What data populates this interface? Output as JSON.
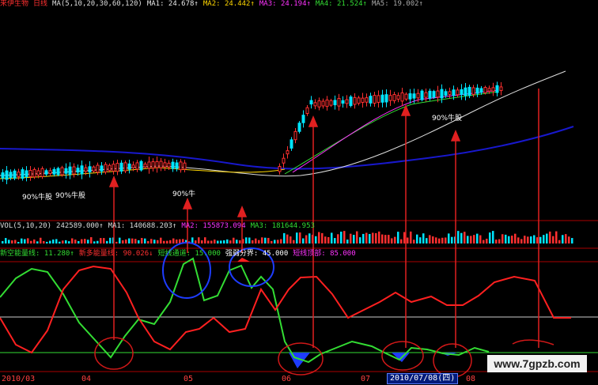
{
  "header": {
    "stock": "来伊生物",
    "period": "日线",
    "ma_label": "MA(5,10,20,30,60,120)",
    "items": [
      {
        "label": "MA1: 24.678↑",
        "color": "#e8e8e8"
      },
      {
        "label": "MA2: 24.442↑",
        "color": "#ffd700"
      },
      {
        "label": "MA3: 24.194↑",
        "color": "#ff33ff"
      },
      {
        "label": "MA4: 21.524↑",
        "color": "#33dd33"
      },
      {
        "label": "MA5: 19.002↑",
        "color": "#aaaaaa"
      }
    ]
  },
  "volume_header": {
    "label": "VOL(5,10,20)",
    "value": "242589.000↑",
    "ma1": "MA1: 140688.203↑",
    "ma2": "MA2: 155873.094",
    "ma3": "MA3: 181644.953"
  },
  "indicator_header": {
    "a": "新空能量线: 11.280↑",
    "b": "新多能量线: 90.026↓",
    "c": "短线通道: 15.000",
    "d": "强弱分界: 45.000",
    "e": "短线顶部: 85.000"
  },
  "annotations": {
    "bull1": "90%牛股",
    "bull2": "90%牛股",
    "bull3": "90%牛",
    "bull4": "90%牛股"
  },
  "dates": {
    "d1": "2010/03",
    "d2": "04",
    "d3": "05",
    "d4": "06",
    "d5": "07",
    "selected": "2010/07/08(四)",
    "d6": "08"
  },
  "watermark": "www.7gpzb.com",
  "colors": {
    "bull": "#ff3030",
    "bear": "#00e5ff",
    "green_line": "#33dd33",
    "red_line": "#ff2020",
    "blue_line": "#1818cc",
    "arrow": "#e02020"
  }
}
